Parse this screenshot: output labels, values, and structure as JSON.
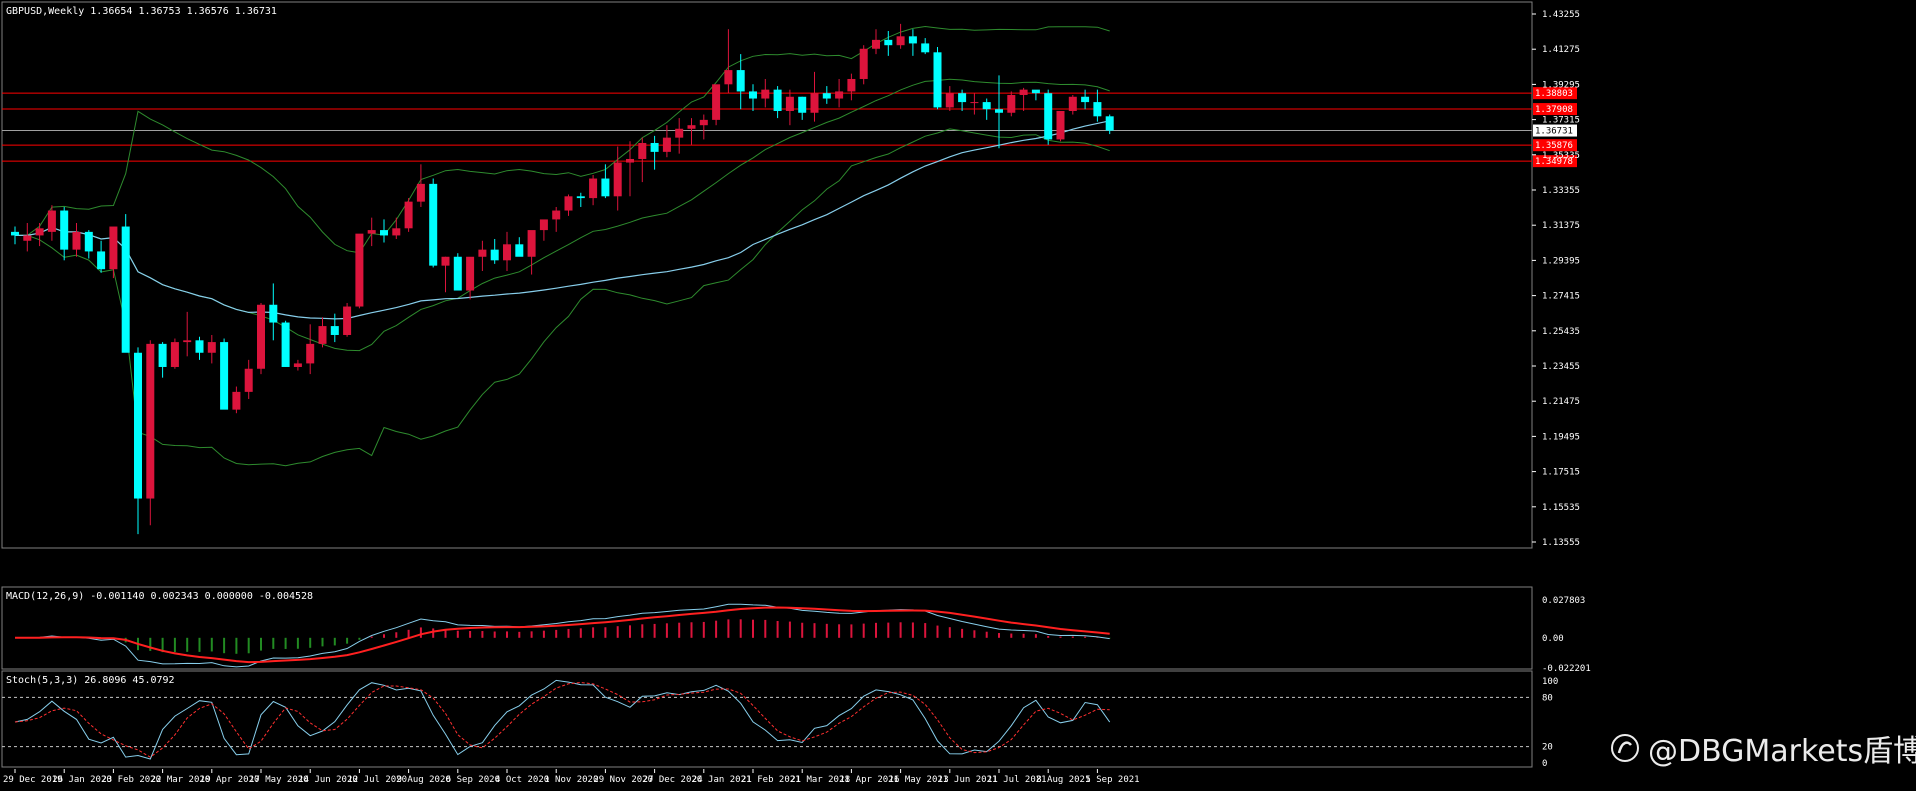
{
  "window": {
    "title": "GBPUSD,Weekly  1.36654 1.36753 1.36576 1.36731"
  },
  "watermark": {
    "text": "@DBGMarkets盾博"
  },
  "colors": {
    "background": "#000000",
    "bull": "#dc143c",
    "bear": "#00ffff",
    "bands": "#2e8b2e",
    "ma": "#87ceeb",
    "level": "#ff0000",
    "macd_line": "#87ceeb",
    "signal_line": "#ff2020",
    "hist_pos": "#dc143c",
    "hist_neg": "#228b22",
    "stoch_main": "#87ceeb",
    "stoch_signal": "#ff3030",
    "grid": "#c8c8c8"
  },
  "price_axis": {
    "ticks": [
      "1.43255",
      "1.41275",
      "1.39295",
      "1.37315",
      "1.35335",
      "1.33355",
      "1.31375",
      "1.29395",
      "1.27415",
      "1.25435",
      "1.23455",
      "1.21475",
      "1.19495",
      "1.17515",
      "1.15535",
      "1.13555"
    ],
    "current_label": "1.36731",
    "level_labels": [
      "1.38803",
      "1.37908",
      "1.35876",
      "1.34978"
    ]
  },
  "time_axis": {
    "labels": [
      "29 Dec 2019",
      "26 Jan 2020",
      "23 Feb 2020",
      "22 Mar 2020",
      "19 Apr 2020",
      "17 May 2020",
      "14 Jun 2020",
      "12 Jul 2020",
      "9 Aug 2020",
      "6 Sep 2020",
      "4 Oct 2020",
      "1 Nov 2020",
      "29 Nov 2020",
      "27 Dec 2020",
      "24 Jan 2021",
      "21 Feb 2021",
      "21 Mar 2021",
      "18 Apr 2021",
      "16 May 2021",
      "13 Jun 2021",
      "11 Jul 2021",
      "8 Aug 2021",
      "5 Sep 2021"
    ]
  },
  "macd_panel": {
    "label": "MACD(12,26,9) -0.001140 0.002343 0.000000 -0.004528",
    "ticks": [
      "0.027803",
      "0.00",
      "-0.022201"
    ]
  },
  "stoch_panel": {
    "label": "Stoch(5,3,3) 26.8096 45.0792",
    "ticks": [
      "100",
      "80",
      "20",
      "0"
    ]
  },
  "chart_data": [
    {
      "type": "candlestick",
      "symbol": "GBPUSD",
      "timeframe": "Weekly",
      "ylim": [
        1.13555,
        1.43255
      ],
      "ohlc": [
        [
          1.31,
          1.313,
          1.303,
          1.308
        ],
        [
          1.305,
          1.315,
          1.299,
          1.308
        ],
        [
          1.308,
          1.315,
          1.302,
          1.312
        ],
        [
          1.31,
          1.325,
          1.305,
          1.322
        ],
        [
          1.322,
          1.324,
          1.294,
          1.3
        ],
        [
          1.3,
          1.315,
          1.296,
          1.31
        ],
        [
          1.31,
          1.311,
          1.295,
          1.299
        ],
        [
          1.299,
          1.305,
          1.287,
          1.289
        ],
        [
          1.289,
          1.307,
          1.284,
          1.313
        ],
        [
          1.313,
          1.32,
          1.27,
          1.242
        ],
        [
          1.242,
          1.245,
          1.14,
          1.16
        ],
        [
          1.16,
          1.249,
          1.145,
          1.247
        ],
        [
          1.247,
          1.248,
          1.228,
          1.234
        ],
        [
          1.234,
          1.25,
          1.233,
          1.248
        ],
        [
          1.248,
          1.265,
          1.24,
          1.249
        ],
        [
          1.249,
          1.251,
          1.238,
          1.242
        ],
        [
          1.242,
          1.252,
          1.236,
          1.248
        ],
        [
          1.248,
          1.25,
          1.227,
          1.21
        ],
        [
          1.21,
          1.223,
          1.208,
          1.22
        ],
        [
          1.22,
          1.238,
          1.216,
          1.233
        ],
        [
          1.233,
          1.27,
          1.23,
          1.269
        ],
        [
          1.269,
          1.281,
          1.249,
          1.259
        ],
        [
          1.259,
          1.26,
          1.234,
          1.234
        ],
        [
          1.234,
          1.238,
          1.232,
          1.236
        ],
        [
          1.236,
          1.258,
          1.23,
          1.247
        ],
        [
          1.247,
          1.262,
          1.245,
          1.257
        ],
        [
          1.257,
          1.264,
          1.248,
          1.252
        ],
        [
          1.252,
          1.27,
          1.251,
          1.268
        ],
        [
          1.268,
          1.303,
          1.267,
          1.309
        ],
        [
          1.309,
          1.318,
          1.302,
          1.311
        ],
        [
          1.311,
          1.317,
          1.304,
          1.308
        ],
        [
          1.308,
          1.318,
          1.306,
          1.312
        ],
        [
          1.312,
          1.329,
          1.31,
          1.327
        ],
        [
          1.327,
          1.348,
          1.324,
          1.337
        ],
        [
          1.337,
          1.34,
          1.29,
          1.291
        ],
        [
          1.291,
          1.296,
          1.276,
          1.296
        ],
        [
          1.296,
          1.298,
          1.279,
          1.277
        ],
        [
          1.277,
          1.295,
          1.272,
          1.296
        ],
        [
          1.296,
          1.305,
          1.288,
          1.3
        ],
        [
          1.3,
          1.306,
          1.292,
          1.294
        ],
        [
          1.294,
          1.31,
          1.288,
          1.303
        ],
        [
          1.303,
          1.307,
          1.298,
          1.296
        ],
        [
          1.296,
          1.307,
          1.286,
          1.311
        ],
        [
          1.311,
          1.316,
          1.305,
          1.317
        ],
        [
          1.317,
          1.324,
          1.31,
          1.322
        ],
        [
          1.322,
          1.331,
          1.319,
          1.33
        ],
        [
          1.33,
          1.332,
          1.324,
          1.329
        ],
        [
          1.329,
          1.342,
          1.325,
          1.34
        ],
        [
          1.34,
          1.348,
          1.329,
          1.33
        ],
        [
          1.33,
          1.358,
          1.322,
          1.349
        ],
        [
          1.349,
          1.361,
          1.33,
          1.351
        ],
        [
          1.351,
          1.363,
          1.338,
          1.36
        ],
        [
          1.36,
          1.364,
          1.345,
          1.355
        ],
        [
          1.355,
          1.37,
          1.352,
          1.363
        ],
        [
          1.363,
          1.374,
          1.354,
          1.368
        ],
        [
          1.368,
          1.374,
          1.359,
          1.37
        ],
        [
          1.37,
          1.376,
          1.362,
          1.373
        ],
        [
          1.373,
          1.391,
          1.37,
          1.393
        ],
        [
          1.393,
          1.424,
          1.388,
          1.401
        ],
        [
          1.401,
          1.41,
          1.379,
          1.389
        ],
        [
          1.389,
          1.393,
          1.378,
          1.385
        ],
        [
          1.385,
          1.396,
          1.38,
          1.39
        ],
        [
          1.39,
          1.392,
          1.374,
          1.378
        ],
        [
          1.378,
          1.39,
          1.37,
          1.386
        ],
        [
          1.386,
          1.386,
          1.373,
          1.377
        ],
        [
          1.377,
          1.4,
          1.372,
          1.388
        ],
        [
          1.388,
          1.392,
          1.382,
          1.385
        ],
        [
          1.385,
          1.396,
          1.38,
          1.389
        ],
        [
          1.389,
          1.399,
          1.384,
          1.396
        ],
        [
          1.396,
          1.415,
          1.393,
          1.413
        ],
        [
          1.413,
          1.424,
          1.41,
          1.418
        ],
        [
          1.418,
          1.423,
          1.409,
          1.415
        ],
        [
          1.415,
          1.427,
          1.413,
          1.42
        ],
        [
          1.42,
          1.424,
          1.409,
          1.416
        ],
        [
          1.416,
          1.419,
          1.41,
          1.411
        ],
        [
          1.411,
          1.414,
          1.379,
          1.38
        ],
        [
          1.38,
          1.392,
          1.378,
          1.388
        ],
        [
          1.388,
          1.39,
          1.378,
          1.383
        ],
        [
          1.383,
          1.388,
          1.376,
          1.383
        ],
        [
          1.383,
          1.385,
          1.373,
          1.379
        ],
        [
          1.379,
          1.398,
          1.357,
          1.377
        ],
        [
          1.377,
          1.389,
          1.375,
          1.387
        ],
        [
          1.387,
          1.391,
          1.378,
          1.39
        ],
        [
          1.39,
          1.388,
          1.384,
          1.388
        ],
        [
          1.388,
          1.39,
          1.359,
          1.362
        ],
        [
          1.362,
          1.378,
          1.361,
          1.378
        ],
        [
          1.378,
          1.387,
          1.376,
          1.386
        ],
        [
          1.386,
          1.39,
          1.379,
          1.383
        ],
        [
          1.383,
          1.39,
          1.372,
          1.375
        ],
        [
          1.375,
          1.376,
          1.365,
          1.367
        ]
      ],
      "levels": [
        1.38803,
        1.37908,
        1.35876,
        1.34978
      ]
    },
    {
      "type": "line",
      "panel": "MACD(12,26,9)",
      "ylim": [
        -0.022201,
        0.027803
      ]
    },
    {
      "type": "line",
      "panel": "Stoch(5,3,3)",
      "ylim": [
        0,
        100
      ],
      "levels": [
        80,
        20
      ]
    }
  ]
}
